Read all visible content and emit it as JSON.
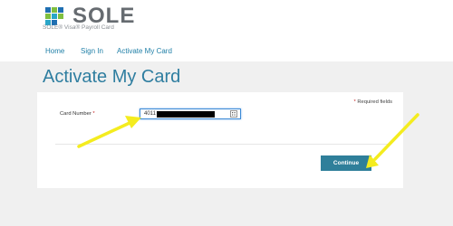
{
  "header": {
    "logo_text": "SOLE",
    "logo_subtitle": "SOLE® Visa® Payroll Card",
    "nav": [
      "Home",
      "Sign In",
      "Activate My Card"
    ]
  },
  "page": {
    "title": "Activate My Card"
  },
  "form": {
    "required_note": "Required fields",
    "card_number_label": "Card Number",
    "card_number_value": "4011",
    "continue_label": "Continue"
  },
  "colors": {
    "accent": "#2f7ea0",
    "button": "#2f7f9a",
    "annotation": "#f4ec1f"
  }
}
